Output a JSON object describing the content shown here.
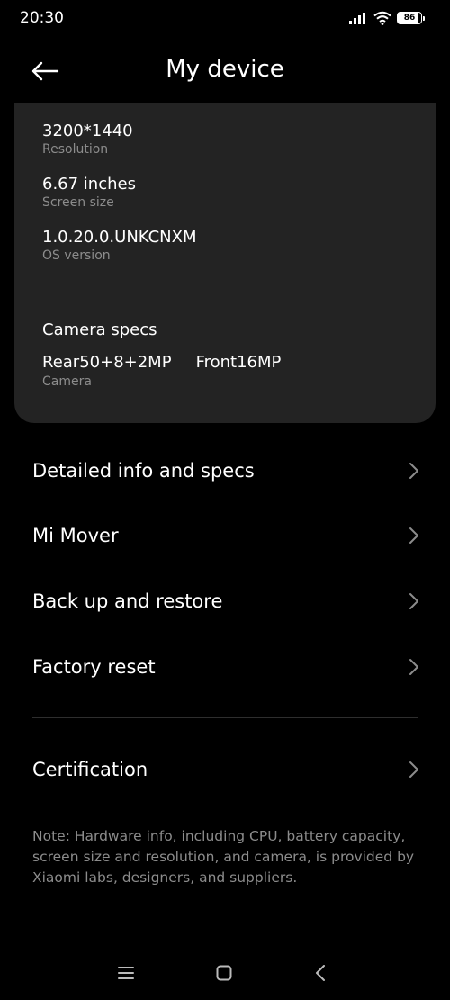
{
  "status_bar": {
    "time": "20:30",
    "battery_level": "86"
  },
  "header": {
    "title": "My device",
    "back_icon": "arrow-left-icon"
  },
  "specs": {
    "items": [
      {
        "value": "3200*1440",
        "label": "Resolution"
      },
      {
        "value": "6.67 inches",
        "label": "Screen size"
      },
      {
        "value": "1.0.20.0.UNKCNXM",
        "label": "OS version"
      }
    ],
    "camera_title": "Camera specs",
    "camera_rear": "Rear50+8+2MP",
    "camera_front": "Front16MP",
    "camera_label": "Camera"
  },
  "menu": {
    "items": [
      {
        "label": "Detailed info and specs"
      },
      {
        "label": "Mi Mover"
      },
      {
        "label": "Back up and restore"
      },
      {
        "label": "Factory reset"
      }
    ],
    "certification": "Certification"
  },
  "note": "Note: Hardware info, including CPU, battery capacity, screen size and resolution, and camera, is provided by Xiaomi labs, designers, and suppliers.",
  "nav": {
    "menu_icon": "menu-icon",
    "home_icon": "home-icon",
    "back_icon": "back-chevron-icon"
  },
  "colors": {
    "background": "#000000",
    "card": "#232323",
    "secondary_text": "#8c8c8c"
  }
}
